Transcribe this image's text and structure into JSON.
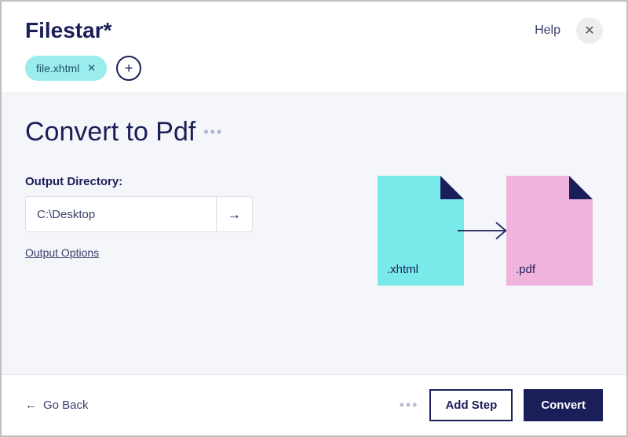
{
  "header": {
    "app_title": "Filestar*",
    "help_label": "Help"
  },
  "files": {
    "chips": [
      {
        "name": "file.xhtml"
      }
    ]
  },
  "main": {
    "title": "Convert to Pdf",
    "output_label": "Output Directory:",
    "output_value": "C:\\Desktop",
    "options_link": "Output Options"
  },
  "diagram": {
    "source_ext": ".xhtml",
    "target_ext": ".pdf"
  },
  "footer": {
    "back_label": "Go Back",
    "add_step_label": "Add Step",
    "convert_label": "Convert"
  }
}
